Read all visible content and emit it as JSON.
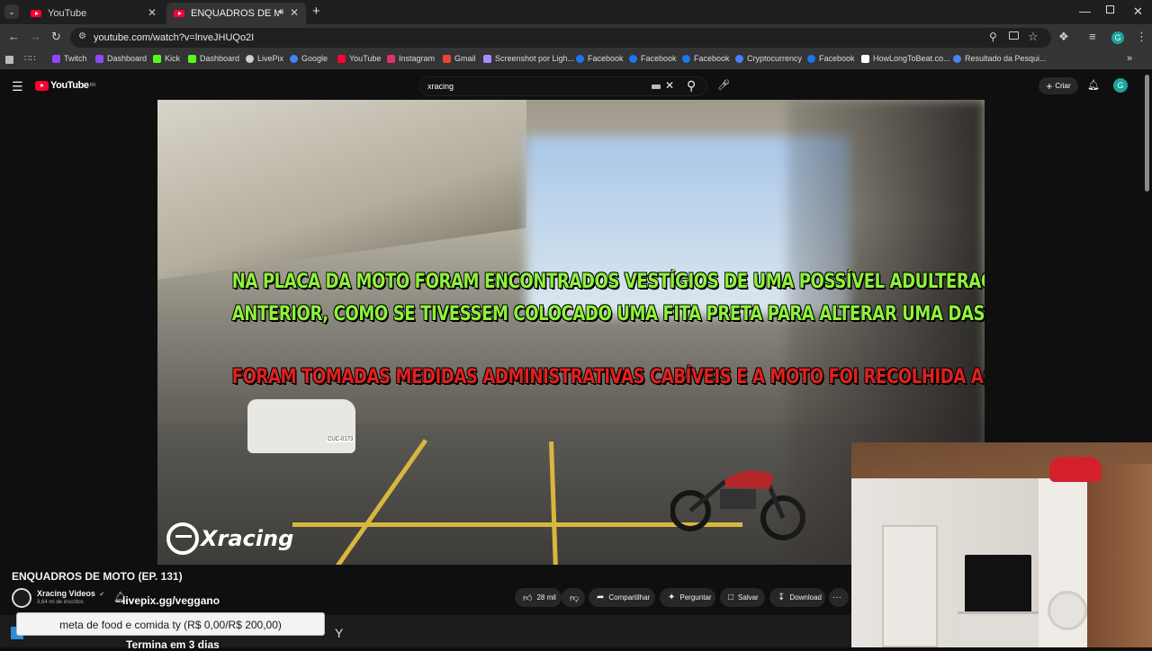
{
  "browser": {
    "tabs": [
      {
        "label": "YouTube",
        "active": false
      },
      {
        "label": "ENQUADROS DE MOTO (EP",
        "active": true
      }
    ],
    "new_tab": "+",
    "url": "youtube.com/watch?v=lnveJHUQo2I",
    "bookmarks": [
      {
        "label": "Twitch",
        "icon": "twitch-icon",
        "color": "#9146ff"
      },
      {
        "label": "Dashboard",
        "icon": "twitch-icon",
        "color": "#9146ff"
      },
      {
        "label": "Kick",
        "icon": "kick-icon",
        "color": "#53fc18"
      },
      {
        "label": "Dashboard",
        "icon": "kick-icon",
        "color": "#53fc18"
      },
      {
        "label": "LivePix",
        "icon": "livepix-icon",
        "color": "#cfcfcf"
      },
      {
        "label": "Google",
        "icon": "google-icon",
        "color": "#4285f4"
      },
      {
        "label": "YouTube",
        "icon": "youtube-icon",
        "color": "#ff0033"
      },
      {
        "label": "Instagram",
        "icon": "instagram-icon",
        "color": "#e1306c"
      },
      {
        "label": "Gmail",
        "icon": "gmail-icon",
        "color": "#ea4335"
      },
      {
        "label": "Screenshot por Ligh...",
        "icon": "lightshot-icon",
        "color": "#a78bfa"
      },
      {
        "label": "Facebook",
        "icon": "facebook-icon",
        "color": "#1877f2"
      },
      {
        "label": "Facebook",
        "icon": "facebook-icon",
        "color": "#1877f2"
      },
      {
        "label": "Facebook",
        "icon": "facebook-icon",
        "color": "#1877f2"
      },
      {
        "label": "Cryptocurrency",
        "icon": "crypto-icon",
        "color": "#4f7cff"
      },
      {
        "label": "Facebook",
        "icon": "facebook-icon",
        "color": "#1877f2"
      },
      {
        "label": "HowLongToBeat.co...",
        "icon": "hltb-icon",
        "color": "#ffffff"
      },
      {
        "label": "Resultado da Pesqui...",
        "icon": "google-icon",
        "color": "#4285f4"
      }
    ],
    "bookmarks_more": "»"
  },
  "youtube": {
    "logo_text": "YouTube",
    "logo_country": "BR",
    "search_value": "xracing",
    "create_label": "Criar",
    "avatar_letter": "G"
  },
  "video": {
    "subtitle_line1": "NA PLACA DA MOTO FORAM ENCONTRADOS VESTÍGIOS DE UMA POSSÍVEL ADULTERAÇÃO",
    "subtitle_line2": "ANTERIOR, COMO SE TIVESSEM COLOCADO UMA FITA PRETA PARA ALTERAR UMA DAS LETRAS.",
    "subtitle_line3": "FORAM TOMADAS MEDIDAS ADMINISTRATIVAS CABÍVEIS E A MOTO FOI RECOLHIDA AO PÁTIO.",
    "watermark": "Xracing",
    "plate_text": "CUC-0173"
  },
  "details": {
    "title": "ENQUADROS DE MOTO (EP. 131)",
    "channel_name": "Xracing Videos",
    "subscribers": "3,64 mi de inscritos",
    "likes": "28 mil",
    "share": "Compartilhar",
    "ask": "Perguntar",
    "save": "Salvar",
    "download": "Download",
    "more": "···"
  },
  "stream_overlay": {
    "livepix": "livepix.gg/veggano",
    "goal": "meta de food e comida ty (R$ 0,00/R$ 200,00)",
    "countdown": "Termina em 3 dias"
  },
  "colors": {
    "subtitle_green": "#8ef23a",
    "subtitle_red": "#e0201f",
    "youtube_red": "#ff0033",
    "avatar_bg": "#1ba39c"
  }
}
